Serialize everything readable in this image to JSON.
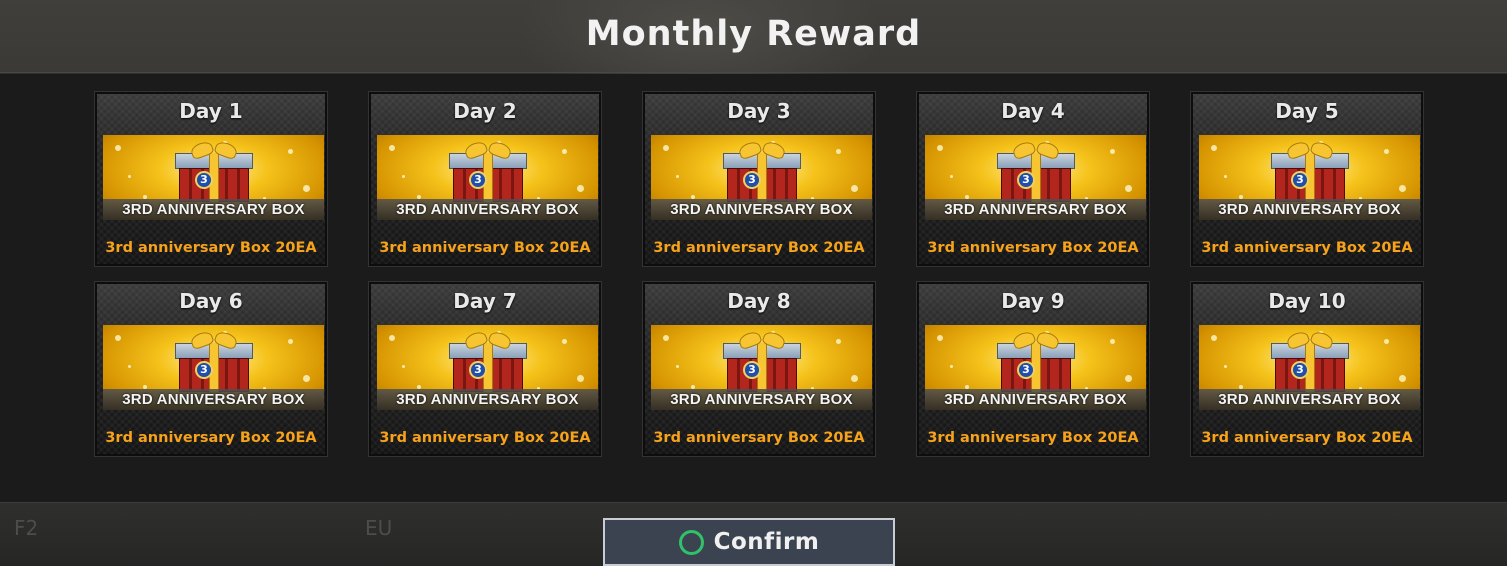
{
  "screen": {
    "title": "Monthly Reward"
  },
  "rewards": [
    {
      "day": "Day 1",
      "banner": "3RD ANNIVERSARY BOX",
      "badge": "3",
      "reward": "3rd anniversary Box 20EA"
    },
    {
      "day": "Day 2",
      "banner": "3RD ANNIVERSARY BOX",
      "badge": "3",
      "reward": "3rd anniversary Box 20EA"
    },
    {
      "day": "Day 3",
      "banner": "3RD ANNIVERSARY BOX",
      "badge": "3",
      "reward": "3rd anniversary Box 20EA"
    },
    {
      "day": "Day 4",
      "banner": "3RD ANNIVERSARY BOX",
      "badge": "3",
      "reward": "3rd anniversary Box 20EA"
    },
    {
      "day": "Day 5",
      "banner": "3RD ANNIVERSARY BOX",
      "badge": "3",
      "reward": "3rd anniversary Box 20EA"
    },
    {
      "day": "Day 6",
      "banner": "3RD ANNIVERSARY BOX",
      "badge": "3",
      "reward": "3rd anniversary Box 20EA"
    },
    {
      "day": "Day 7",
      "banner": "3RD ANNIVERSARY BOX",
      "badge": "3",
      "reward": "3rd anniversary Box 20EA"
    },
    {
      "day": "Day 8",
      "banner": "3RD ANNIVERSARY BOX",
      "badge": "3",
      "reward": "3rd anniversary Box 20EA"
    },
    {
      "day": "Day 9",
      "banner": "3RD ANNIVERSARY BOX",
      "badge": "3",
      "reward": "3rd anniversary Box 20EA"
    },
    {
      "day": "Day 10",
      "banner": "3RD ANNIVERSARY BOX",
      "badge": "3",
      "reward": "3rd anniversary Box 20EA"
    }
  ],
  "footer": {
    "background_labels": [
      "F2",
      "EU"
    ],
    "confirm_label": "Confirm",
    "confirm_icon": "circle-button-icon"
  },
  "colors": {
    "reward_text": "#f6a21a",
    "confirm_icon": "#2fc26a",
    "confirm_bg": "#3c4350"
  }
}
